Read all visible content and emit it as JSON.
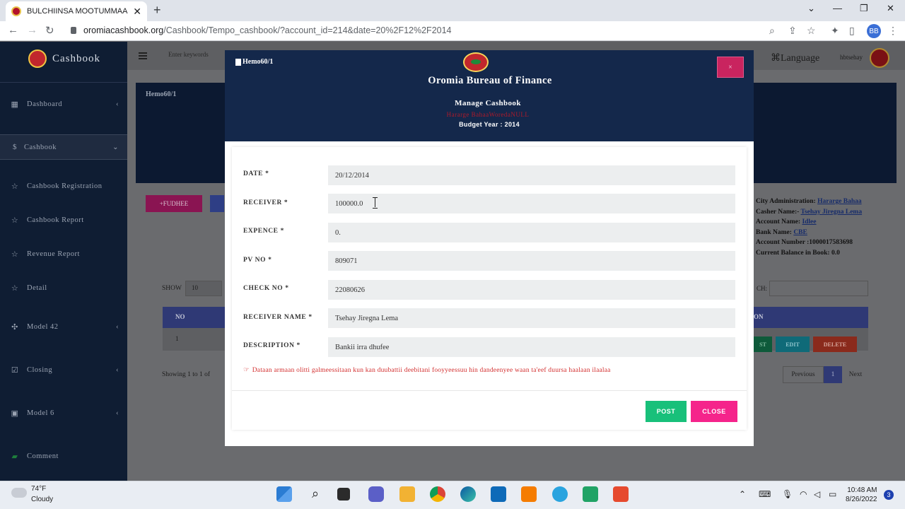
{
  "browser": {
    "tab_title": "BULCHIINSA MOOTUMMAA NA",
    "url_host": "oromiacashbook.org",
    "url_path": "/Cashbook/Tempo_cashbook/?account_id=214&date=20%2F12%2F2014",
    "profile_initials": "BB"
  },
  "sidebar": {
    "brand": "Cashbook",
    "items": [
      {
        "label": "Dashboard",
        "icon": "grid-icon"
      },
      {
        "label": "Cashbook",
        "icon": "dollar-icon"
      },
      {
        "label": "Cashbook Registration",
        "icon": "star-icon"
      },
      {
        "label": "Cashbook Report",
        "icon": "star-icon"
      },
      {
        "label": "Revenue Report",
        "icon": "star-icon"
      },
      {
        "label": "Detail",
        "icon": "star-icon"
      },
      {
        "label": "Model 42",
        "icon": "nodes-icon"
      },
      {
        "label": "Closing",
        "icon": "check-square-icon"
      },
      {
        "label": "Model 6",
        "icon": "briefcase-icon"
      },
      {
        "label": "Comment",
        "icon": "comment-icon"
      }
    ]
  },
  "topnav": {
    "search_placeholder": "Enter keywords",
    "language": "Language",
    "user": "hbtsehay"
  },
  "main": {
    "header_title": "Hemo60/1",
    "add_button": "+FUDHEE",
    "account": {
      "city_label": "City Administration:",
      "city_value": "Hararge Bahaa",
      "casher_label": "Casher Name:-",
      "casher_value": "Tsehay Jiregna Lema",
      "account_name_label": "Account Name:",
      "account_name_value": "Idlee",
      "bank_label": "Bank Name:",
      "bank_value": "CBE",
      "account_number": "Account Number :1000017583698",
      "balance": "Current Balance in Book: 0.0"
    },
    "show_label": "SHOW",
    "show_value": "10",
    "search_label": "CH:",
    "table": {
      "col_no": "NO",
      "col_action": "ON",
      "row_no": "1",
      "post": "ST",
      "edit": "EDIT",
      "delete": "DELETE"
    },
    "showing": "Showing 1 to 1 of",
    "pagination": {
      "prev": "Previous",
      "page": "1",
      "next": "Next"
    }
  },
  "modal": {
    "ref": "Hemo60/1",
    "org": "Oromia Bureau of Finance",
    "subtitle": "Manage Cashbook",
    "location": "Hararge BahaaWoredaNULL",
    "budget_year": "Budget Year : 2014",
    "close_x": "×",
    "fields": [
      {
        "label": "DATE *",
        "value": "20/12/2014"
      },
      {
        "label": "RECEIVER *",
        "value": "100000.0"
      },
      {
        "label": "EXPENCE *",
        "value": "0."
      },
      {
        "label": "PV NO *",
        "value": "809071"
      },
      {
        "label": "CHECK NO *",
        "value": "22080626"
      },
      {
        "label": "RECEIVER NAME *",
        "value": "Tsehay Jiregna Lema"
      },
      {
        "label": "DESCRIPTION *",
        "value": "Bankii irra dhufee"
      }
    ],
    "warning": "Dataan armaan olitti galmeessitaan kun kan duubattii deebitani fooyyeessuu hin dandeenyee waan ta'eef duursa haalaan ilaalaa",
    "post_button": "POST",
    "close_button": "CLOSE"
  },
  "taskbar": {
    "temp": "74°F",
    "condition": "Cloudy",
    "time": "10:48 AM",
    "date": "8/26/2022",
    "notifications": "3"
  }
}
